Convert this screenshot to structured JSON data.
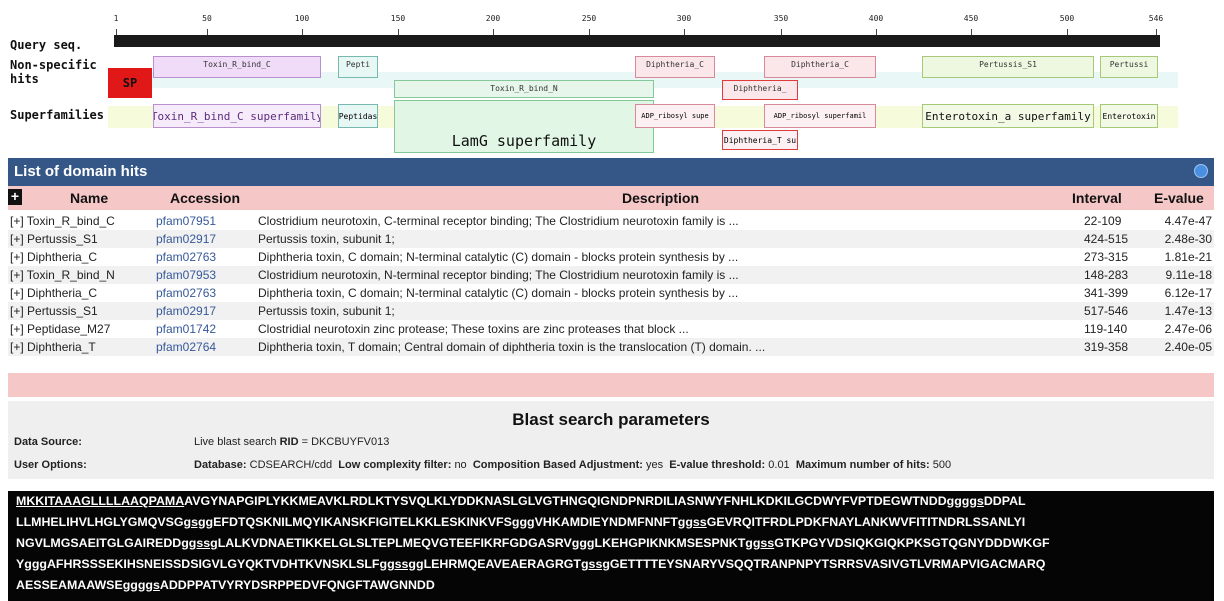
{
  "graphic": {
    "ticks": [
      "1",
      "50",
      "100",
      "150",
      "200",
      "250",
      "300",
      "350",
      "400",
      "450",
      "500",
      "546"
    ],
    "row_labels": {
      "query": "Query seq.",
      "nonspecific": "Non-specific hits",
      "superfamilies": "Superfamilies"
    },
    "sp_label": "SP",
    "hits": {
      "toxin_r_bind_c": "Toxin_R_bind_C",
      "pepti": "Pepti",
      "toxin_r_bind_n": "Toxin_R_bind_N",
      "diphtheria_c_1": "Diphtheria_C",
      "diphtheria_c_2": "Diphtheria_C",
      "diphtheria_t": "Diphtheria_",
      "pertussis_s1_1": "Pertussis_S1",
      "pertussis_s1_2": "Pertussi"
    },
    "superfamilies": {
      "toxin_c_sf": "Toxin_R_bind_C superfamily",
      "peptidas": "Peptidas",
      "lamg": "LamG superfamily",
      "adp1": "ADP_ribosyl supe",
      "adp2": "ADP_ribosyl superfamil",
      "diph_t_sf": "Diphtheria_T su",
      "enterotoxin_sf": "Enterotoxin_a superfamily",
      "enterotoxin": "Enterotoxin"
    }
  },
  "hits_table": {
    "title": "List of domain hits",
    "expand_all": "+",
    "columns": {
      "name": "Name",
      "accession": "Accession",
      "description": "Description",
      "interval": "Interval",
      "evalue": "E-value"
    },
    "rows": [
      {
        "name": "[+] Toxin_R_bind_C",
        "accession": "pfam07951",
        "description": "Clostridium neurotoxin, C-terminal receptor binding; The Clostridium neurotoxin family is ...",
        "interval": "22-109",
        "evalue": "4.47e-47"
      },
      {
        "name": "[+] Pertussis_S1",
        "accession": "pfam02917",
        "description": "Pertussis toxin, subunit 1;",
        "interval": "424-515",
        "evalue": "2.48e-30"
      },
      {
        "name": "[+] Diphtheria_C",
        "accession": "pfam02763",
        "description": "Diphtheria toxin, C domain; N-terminal catalytic (C) domain - blocks protein synthesis by ...",
        "interval": "273-315",
        "evalue": "1.81e-21"
      },
      {
        "name": "[+] Toxin_R_bind_N",
        "accession": "pfam07953",
        "description": "Clostridium neurotoxin, N-terminal receptor binding; The Clostridium neurotoxin family is ...",
        "interval": "148-283",
        "evalue": "9.11e-18"
      },
      {
        "name": "[+] Diphtheria_C",
        "accession": "pfam02763",
        "description": "Diphtheria toxin, C domain; N-terminal catalytic (C) domain - blocks protein synthesis by ...",
        "interval": "341-399",
        "evalue": "6.12e-17"
      },
      {
        "name": "[+] Pertussis_S1",
        "accession": "pfam02917",
        "description": "Pertussis toxin, subunit 1;",
        "interval": "517-546",
        "evalue": "1.47e-13"
      },
      {
        "name": "[+] Peptidase_M27",
        "accession": "pfam01742",
        "description": "Clostridial neurotoxin zinc protease; These toxins are zinc proteases that block ...",
        "interval": "119-140",
        "evalue": "2.47e-06"
      },
      {
        "name": "[+] Diphtheria_T",
        "accession": "pfam02764",
        "description": "Diphtheria toxin, T domain; Central domain of diphtheria toxin is the translocation (T) domain. ...",
        "interval": "319-358",
        "evalue": "2.40e-05"
      }
    ]
  },
  "params": {
    "title": "Blast search parameters",
    "data_source_label": "Data Source:",
    "data_source_prefix": "Live blast search",
    "rid_label": "RID",
    "rid_value": "= DKCBUYFV013",
    "user_options_label": "User Options:",
    "database_label": "Database:",
    "database_value": "CDSEARCH/cdd",
    "low_complexity_label": "Low complexity filter:",
    "low_complexity_value": "no",
    "composition_label": "Composition Based Adjustment:",
    "composition_value": "yes",
    "evalue_label": "E-value threshold:",
    "evalue_value": "0.01",
    "max_hits_label": "Maximum number of hits:",
    "max_hits_value": "500"
  },
  "sequence": {
    "lines": [
      [
        {
          "t": "MKKITAAAGLLLLAAQPAMA",
          "u": true
        },
        {
          "t": "AVGYNAPGIPLYKKMEAVKLRDLKTYSVQLKLYDDKNASLGLVGTHNGQIGNDPNRDILIASNWYFNHLKDKILGCDWYFVPTDEGWTNDD"
        },
        {
          "t": "ggggs",
          "u": true
        },
        {
          "t": "DDPAL"
        }
      ],
      [
        {
          "t": "LLMHELIHVLHGLYGMQVSG"
        },
        {
          "t": "gsgg",
          "u": true
        },
        {
          "t": "EFDTQSKNILMQYIKANSKFIGITELKKLESKINKVFS"
        },
        {
          "t": "ggg",
          "u": true
        },
        {
          "t": "VHKAMDIEYNDMFNNFT"
        },
        {
          "t": "ggss",
          "u": true
        },
        {
          "t": "GEVRQITFRDLPDKFNAYLANKWVFITITNDRLSSANLYI"
        }
      ],
      [
        {
          "t": "NGVLMGSAEITGLGAIREDD"
        },
        {
          "t": "ggssg",
          "u": true
        },
        {
          "t": "LALKVDNAETIKKELGLSLTEPLMEQVGTEEFIKRFGDGASRV"
        },
        {
          "t": "ggg",
          "u": true
        },
        {
          "t": "LKEHGPIKNKMSESPNKT"
        },
        {
          "t": "ggss",
          "u": true
        },
        {
          "t": "GTKPGYVDSIQKGIQKPKSGTQGNYDDDWKGF"
        }
      ],
      [
        {
          "t": "Y"
        },
        {
          "t": "ggg",
          "u": true
        },
        {
          "t": "AFHRSSSEKIHSNEISSDSIGVLGYQKTVDHTKVNSKLSLF"
        },
        {
          "t": "ggssgg",
          "u": true
        },
        {
          "t": "LEHRMQEAVEAERAGRGT"
        },
        {
          "t": "gssg",
          "u": true
        },
        {
          "t": "GETTTTEYSNARYVSQQTRANPNPYTSRRSVASIVGTLVRMAPVIGACMARQ"
        }
      ],
      [
        {
          "t": "AESSEAMAAWSE"
        },
        {
          "t": "ggggs",
          "u": true
        },
        {
          "t": "ADDPPATVYRYDSRPPEDVFQNGFTAWGNNDD"
        }
      ]
    ]
  },
  "colors": {
    "header_blue": "#355787",
    "column_pink": "#f6c7c7",
    "accession_blue": "#36599a",
    "sp_red": "#e01818",
    "sequence_bg": "#050505"
  }
}
